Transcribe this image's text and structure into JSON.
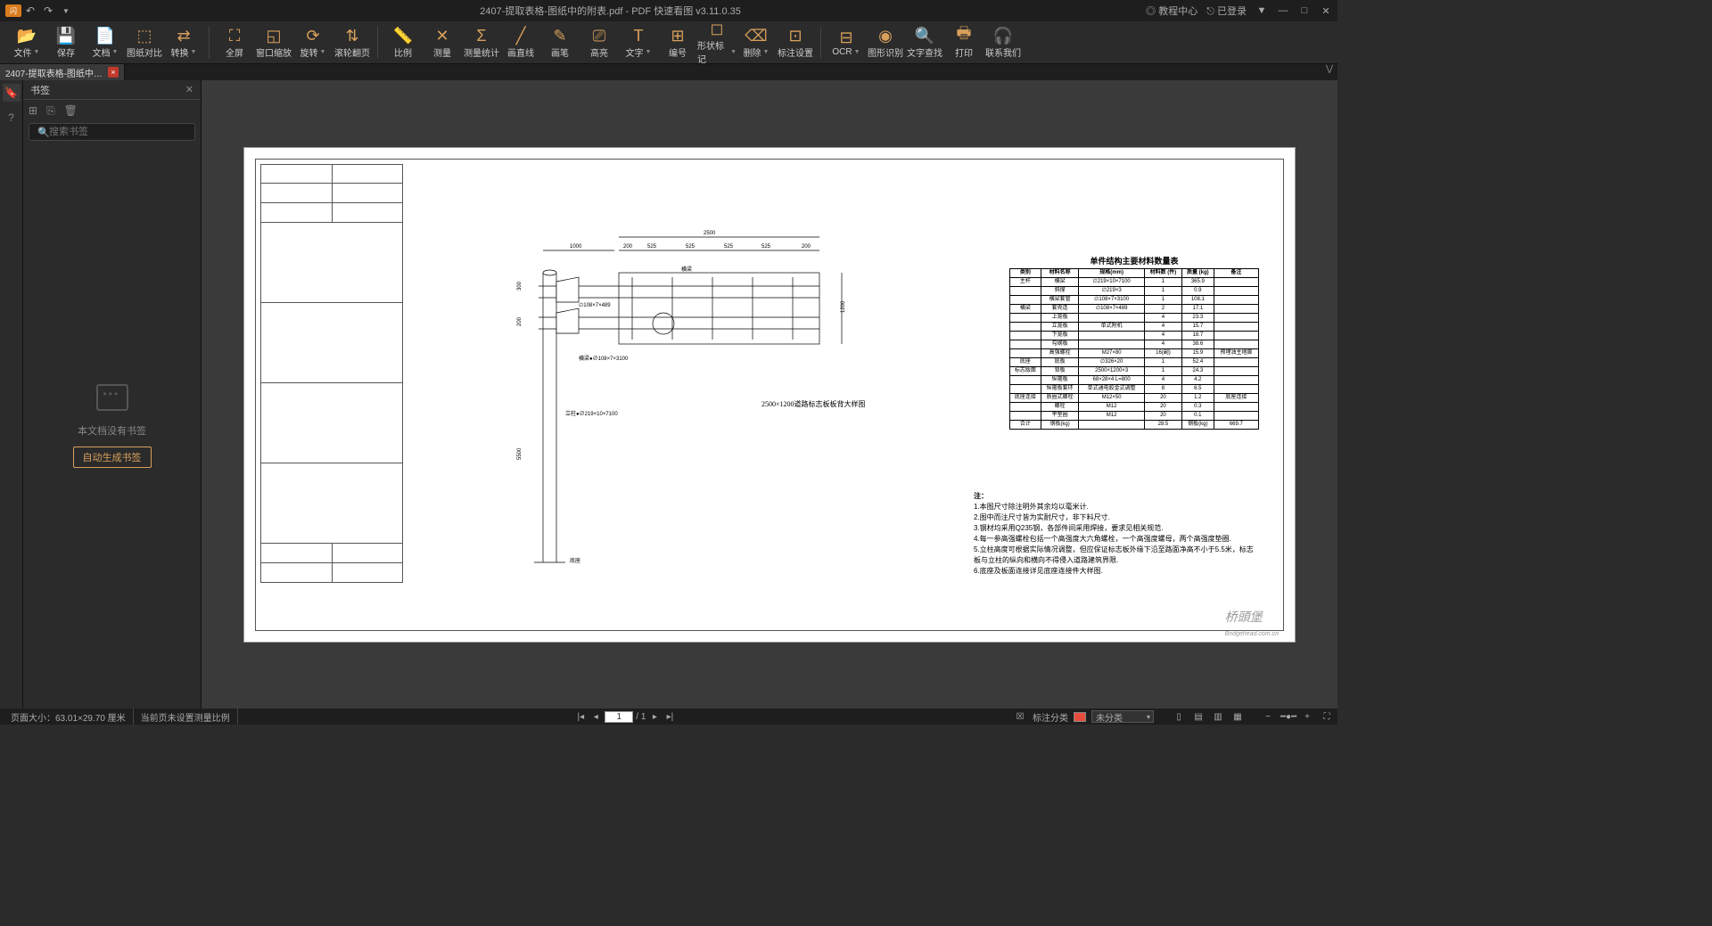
{
  "titlebar": {
    "title": "2407-提取表格-图纸中的附表.pdf - PDF 快速看图 v3.11.0.35",
    "help": "教程中心",
    "login": "已登录"
  },
  "toolbar": {
    "file": "文件",
    "save": "保存",
    "doc": "文档",
    "compare": "图纸对比",
    "convert": "转换",
    "fullscreen": "全屏",
    "fitwindow": "窗口缩放",
    "rotate": "旋转",
    "scroll": "滚轮翻页",
    "scale": "比例",
    "measure": "测量",
    "measurestat": "测量统计",
    "line": "画直线",
    "pen": "画笔",
    "highlight": "高亮",
    "text": "文字",
    "number": "编号",
    "shape": "形状标记",
    "delete": "删除",
    "annotset": "标注设置",
    "ocr": "OCR",
    "imgrec": "图形识别",
    "textsearch": "文字查找",
    "print": "打印",
    "contact": "联系我们"
  },
  "doctab": {
    "label": "2407-提取表格-图纸中…"
  },
  "bookmark": {
    "title": "书签",
    "placeholder": "搜索书签",
    "empty": "本文档没有书签",
    "autogen": "自动生成书签"
  },
  "drawing": {
    "caption": "2500×1200道路标志板板背大样图",
    "table_title": "单件结构主要材料数量表",
    "headers": [
      "类别",
      "材料名称",
      "规格(mm)",
      "材料数 (件)",
      "质量 (kg)",
      "备注"
    ],
    "rows": [
      [
        "主杆",
        "横梁",
        "∅219×10×7100",
        "1",
        "365.9",
        ""
      ],
      [
        "",
        "斜撑",
        "∅219×3",
        "1",
        "0.9",
        ""
      ],
      [
        "",
        "横梁套管",
        "∅108×7×3100",
        "1",
        "108.1",
        ""
      ],
      [
        "横梁",
        "套壳连",
        "∅108×7×489",
        "2",
        "17.1",
        ""
      ],
      [
        "",
        "上笼板",
        "",
        "4",
        "23.3",
        ""
      ],
      [
        "",
        "立笼板",
        "单式附机",
        "4",
        "15.7",
        ""
      ],
      [
        "",
        "下笼板",
        "",
        "4",
        "18.7",
        ""
      ],
      [
        "",
        "勾纲板",
        "",
        "4",
        "38.6",
        ""
      ],
      [
        "",
        "高强螺栓",
        "M27×80",
        "16(副)",
        "15.9",
        "预埋油主地脚"
      ],
      [
        "底座",
        "底板",
        "∅326×20",
        "1",
        "52.4",
        ""
      ],
      [
        "标志版面",
        "背板",
        "2500×1200×3",
        "1",
        "24.3",
        ""
      ],
      [
        "",
        "纵箍板",
        "68×28×4 L=800",
        "4",
        "4.2",
        ""
      ],
      [
        "",
        "纵箍板套环",
        "单式通电胶金式调整",
        "8",
        "6.5",
        ""
      ],
      [
        "底座连接",
        "质圈式螺栓",
        "M12×50",
        "20",
        "1.2",
        "底座连接"
      ],
      [
        "",
        "螺栓",
        "M12",
        "20",
        "0.3",
        ""
      ],
      [
        "",
        "平垫圈",
        "M12",
        "20",
        "0.1",
        ""
      ],
      [
        "合计",
        "钢板(kg)",
        "",
        "28.5",
        "钢板(kg)",
        "669.7"
      ]
    ],
    "notes_hdr": "注：",
    "notes": [
      "1.本图尺寸除注明外其余均以毫米计.",
      "2.图中而注尺寸皆为实耐尺寸，非下料尺寸.",
      "3.钢材均采用Q235钢，各部件间采用焊接，要求见相关规范.",
      "4.每一参高强螺栓包括一个高强度大六角螺栓，一个高强度螺母，两个高强度垫圈.",
      "5.立柱高度可根据实际情况调整，但应保证标志板外缘下沿至路面净高不小于5.5米，标志板与立柱的纵向和横向不得侵入道路建筑界限.",
      "6.底座及板面连接详见底座连接件大样图."
    ],
    "dims": {
      "top1": "1000",
      "top2": "2500",
      "s1": "200",
      "s2": "525",
      "s3": "525",
      "s4": "525",
      "s5": "525",
      "s6": "200",
      "v1": "300",
      "v2": "200",
      "v3": "1200",
      "v4": "5500",
      "label1": "横梁",
      "label2": "∅108×7×489",
      "label3": "横梁●∅108×7×3100",
      "label4": "立柱●∅219×10×7100",
      "label5": "底座"
    }
  },
  "statusbar": {
    "pagesize": "页面大小：63.01×29.70 厘米",
    "noscale": "当前页未设置测量比例",
    "page": "1",
    "total": "/  1",
    "annot": "标注分类",
    "unclass": "未分类"
  },
  "watermark": "桥頭堡\nBridgehead.com.cn"
}
